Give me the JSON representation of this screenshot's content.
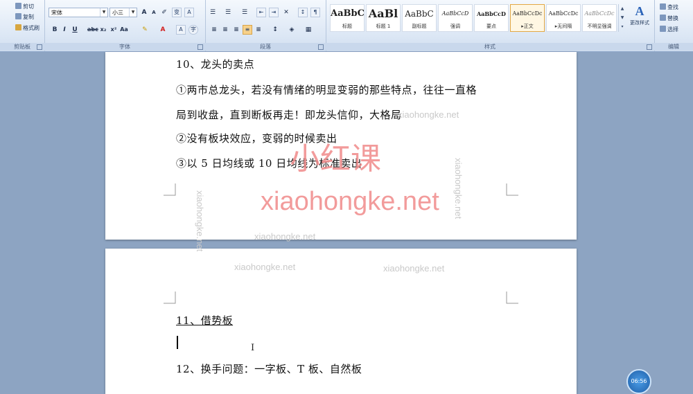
{
  "ribbon": {
    "clipboard": {
      "label": "剪贴板",
      "cut": "剪切",
      "copy": "复制",
      "format_painter": "格式刷"
    },
    "font": {
      "label": "字体",
      "font_name": "宋体",
      "font_size": "小三"
    },
    "paragraph": {
      "label": "段落"
    },
    "styles": {
      "label": "样式",
      "items": [
        {
          "preview": "AaBbC",
          "name": "标题"
        },
        {
          "preview": "AaBl",
          "name": "标题 1"
        },
        {
          "preview": "AaBbC",
          "name": "副标题"
        },
        {
          "preview": "AaBbCcD",
          "name": "强调"
        },
        {
          "preview": "AaBbCcD",
          "name": "要点"
        },
        {
          "preview": "AaBbCcDc",
          "name": "▸正文"
        },
        {
          "preview": "AaBbCcDc",
          "name": "▸无间隔"
        },
        {
          "preview": "AaBbCcDc",
          "name": "不明显强调"
        }
      ],
      "change_styles": "更改样式"
    },
    "editing": {
      "label": "编辑",
      "find": "查找",
      "replace": "替换",
      "select": "选择"
    }
  },
  "document": {
    "page1_lines": [
      "10、龙头的卖点",
      "①两市总龙头，若没有情绪的明显变弱的那些特点，往往一直格",
      "局到收盘，直到断板再走！即龙头信仰，大格局",
      "②没有板块效应，变弱的时候卖出",
      "③以 5 日均线或 10 日均线为标准卖出"
    ],
    "page2_lines": [
      "11、借势板",
      "12、换手问题：一字板、T 板、自然板"
    ]
  },
  "watermark": {
    "big_cn": "小红课",
    "big_url": "xiaohongke.net",
    "small": "xiaohongke.net"
  },
  "timer": {
    "text": "06:56"
  }
}
